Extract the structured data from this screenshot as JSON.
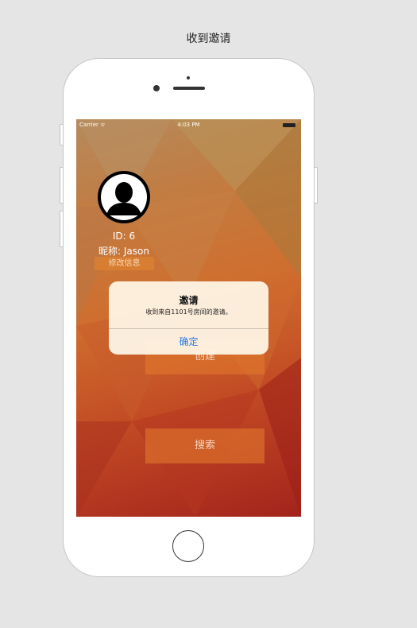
{
  "page": {
    "caption": "收到邀请"
  },
  "status_bar": {
    "carrier": "Carrier ᯤ",
    "time": "4:03 PM"
  },
  "profile": {
    "id_text": "ID: 6",
    "nickname_text": "昵称: Jason",
    "edit_button": "修改信息"
  },
  "actions": {
    "create_button": "创建",
    "search_button": "搜索"
  },
  "alert": {
    "title": "邀请",
    "message": "收到来自1101号房间的邀请。",
    "ok_button": "确定"
  },
  "colors": {
    "alert_button": "#2a7ae2",
    "background": "#e5e5e5"
  }
}
